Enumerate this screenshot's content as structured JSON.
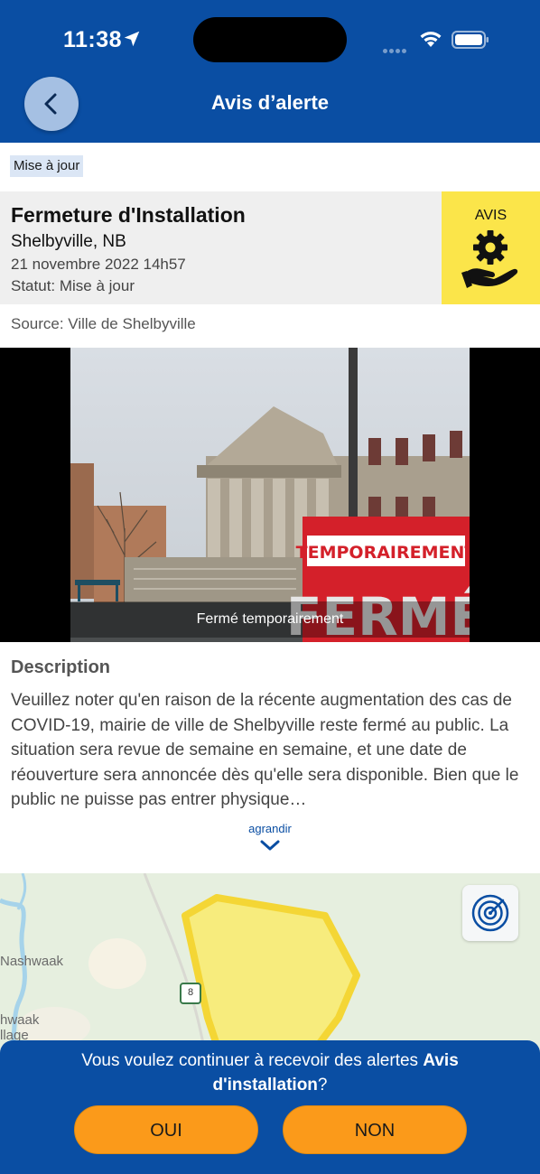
{
  "status_bar": {
    "time": "11:38"
  },
  "nav": {
    "title": "Avis d’alerte"
  },
  "update_tag": "Mise à jour",
  "alert": {
    "title": "Fermeture d'Installation",
    "location": "Shelbyville, NB",
    "date": "21 novembre 2022 14h57",
    "status": "Statut: Mise à jour",
    "category_label": "AVIS",
    "category_icon": "gear-hand-icon",
    "category_color": "#fbe54a"
  },
  "source": "Source: Ville de Shelbyville",
  "image": {
    "caption": "Fermé temporairement",
    "sign_line1": "TEMPORAIREMENT",
    "sign_line2": "FERMÉ"
  },
  "description": {
    "heading": "Description",
    "body": "Veuillez noter qu'en raison de la récente augmentation des cas de COVID-19, mairie de ville de Shelbyville reste fermé au public. La situation sera revue de semaine en semaine, et une date de réouverture sera annoncée dès qu'elle sera disponible. Bien que le public ne puisse pas entrer physique…",
    "expand_label": "agrandir"
  },
  "map": {
    "labels": [
      "Nashwaak",
      "hwaak",
      "llage"
    ],
    "route_number": "8",
    "radar_icon": "radar-icon"
  },
  "prompt": {
    "text_before": "Vous voulez continuer à recevoir des alertes ",
    "text_bold": "Avis d'installation",
    "text_after": "?",
    "yes_label": "OUI",
    "no_label": "NON"
  },
  "colors": {
    "brand_blue": "#0a4ea3",
    "button_orange": "#fb9a1a",
    "alert_yellow": "#fbe54a"
  }
}
